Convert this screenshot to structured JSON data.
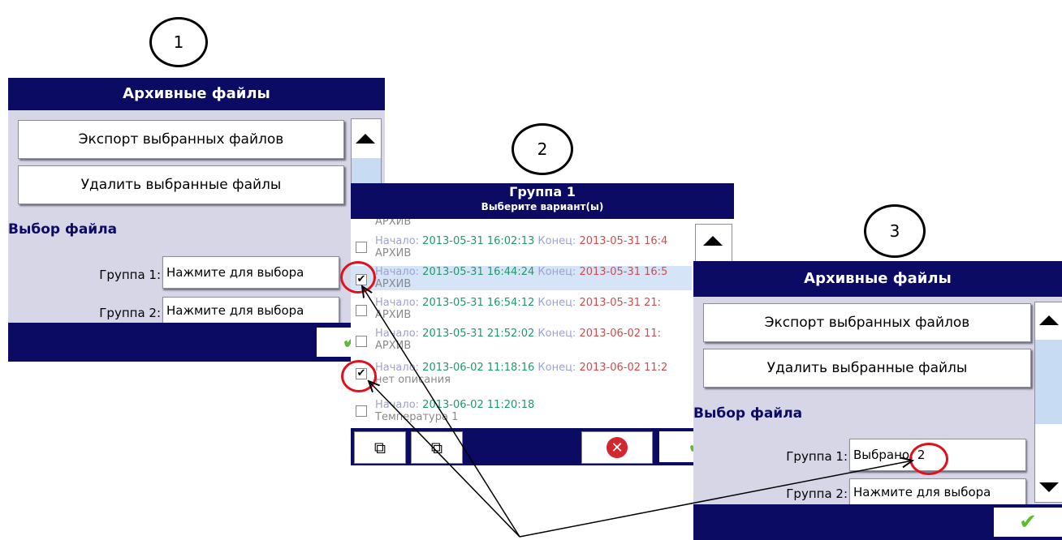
{
  "steps": [
    "1",
    "2",
    "3"
  ],
  "panel1": {
    "title": "Архивные файлы",
    "export_label": "Экспорт выбранных файлов",
    "delete_label": "Удалить выбранные файлы",
    "section": "Выбор файла",
    "group1_label": "Группа 1:",
    "group1_value": "Нажмите для выбора",
    "group2_label": "Группа 2:",
    "group2_value": "Нажмите для выбора"
  },
  "panel2": {
    "title": "Группа 1",
    "subtitle": "Выберите вариант(ы)",
    "partial_top": "АРХИВ",
    "items": [
      {
        "checked": false,
        "start_label": "Начало:",
        "start": "2013-05-31 16:02:13",
        "end_label": "Конец:",
        "end": "2013-05-31 16:4",
        "desc": "АРХИВ"
      },
      {
        "checked": true,
        "start_label": "Начало:",
        "start": "2013-05-31 16:44:24",
        "end_label": "Конец:",
        "end": "2013-05-31 16:5",
        "desc": "АРХИВ"
      },
      {
        "checked": false,
        "start_label": "Начало:",
        "start": "2013-05-31 16:54:12",
        "end_label": "Конец:",
        "end": "2013-05-31 21:",
        "desc": "АРХИВ"
      },
      {
        "checked": false,
        "start_label": "Начало:",
        "start": "2013-05-31 21:52:02",
        "end_label": "Конец:",
        "end": "2013-06-02 11:",
        "desc": "АРХИВ"
      },
      {
        "checked": true,
        "start_label": "Начало:",
        "start": "2013-06-02 11:18:16",
        "end_label": "Конец:",
        "end": "2013-06-02 11:2",
        "desc": "нет описания"
      },
      {
        "checked": false,
        "start_label": "Начало:",
        "start": "2013-06-02 11:20:18",
        "end_label": "",
        "end": "",
        "desc": "Температура 1"
      }
    ]
  },
  "panel3": {
    "title": "Архивные файлы",
    "export_label": "Экспорт выбранных файлов",
    "delete_label": "Удалить выбранные файлы",
    "section": "Выбор файла",
    "group1_label": "Группа 1:",
    "group1_value": "Выбрано: 2",
    "group2_label": "Группа 2:",
    "group2_value": "Нажмите для выбора"
  },
  "colors": {
    "titlebar": "#0b0b63",
    "panel_bg": "#d6d6e6",
    "highlight": "#e0101d",
    "ok_green": "#5dbb2f"
  }
}
